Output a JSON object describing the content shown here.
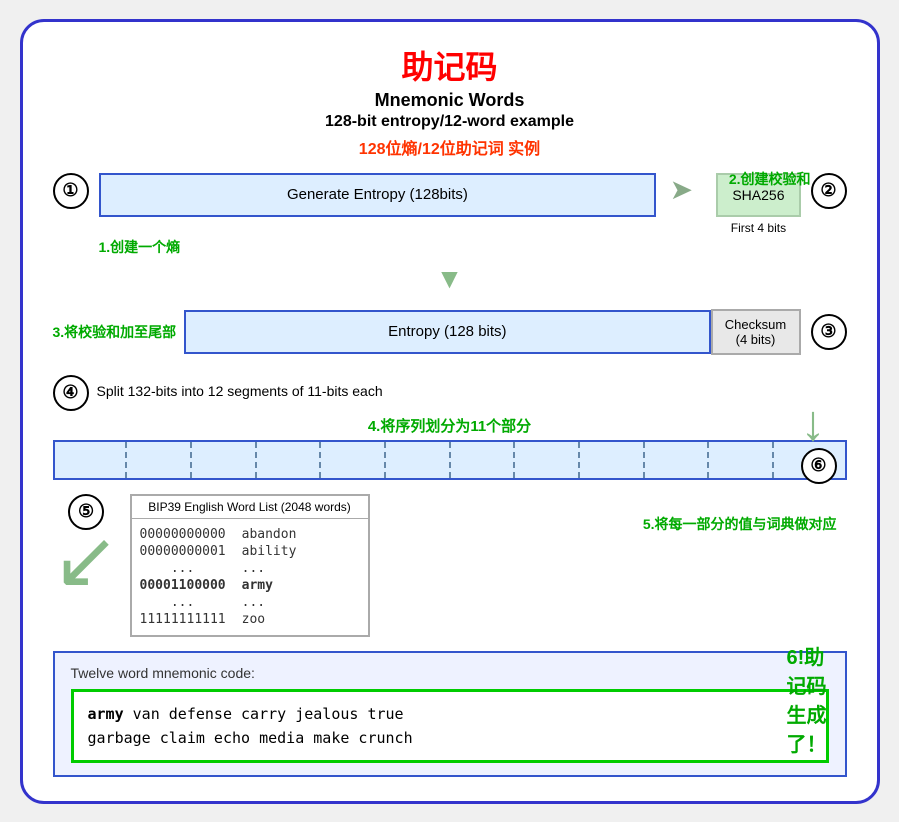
{
  "title": {
    "cn": "助记码",
    "en1": "Mnemonic Words",
    "en2": "128-bit entropy/12-word example",
    "cn_sub": "128位熵/12位助记词 实例"
  },
  "labels": {
    "step1": "1.创建一个熵",
    "step2": "2.创建校验和",
    "step3": "3.将校验和加至尾部",
    "step4": "4.将序列划分为11个部分",
    "step5": "5.将每一部分的值与词典做对应",
    "step6": "6!助记码生成了！"
  },
  "step1": {
    "circle": "①",
    "box_text": "Generate Entropy (128bits)",
    "sha_text": "SHA256",
    "first4": "First 4 bits",
    "circle2": "②"
  },
  "step3": {
    "entropy_text": "Entropy (128 bits)",
    "checksum_text": "Checksum\n(4 bits)",
    "circle": "③"
  },
  "step4": {
    "circle": "④",
    "text": "Split 132-bits into 12 segments of 11-bits each",
    "segments": 12
  },
  "word_list": {
    "title": "BIP39 English Word List (2048 words)",
    "rows": [
      {
        "binary": "00000000000",
        "word": "abandon"
      },
      {
        "binary": "00000000001",
        "word": "ability"
      },
      {
        "binary": "...",
        "word": "..."
      },
      {
        "binary": "00001100000",
        "word": "army"
      },
      {
        "binary": "...",
        "word": "..."
      },
      {
        "binary": "11111111111",
        "word": "zoo"
      }
    ]
  },
  "step5_circle": "⑤",
  "step6_circle": "⑥",
  "output": {
    "label": "Twelve word mnemonic code:",
    "mnemonic_first": "army",
    "mnemonic_rest": " van defense carry jealous true\ngarbage claim echo media make crunch"
  }
}
